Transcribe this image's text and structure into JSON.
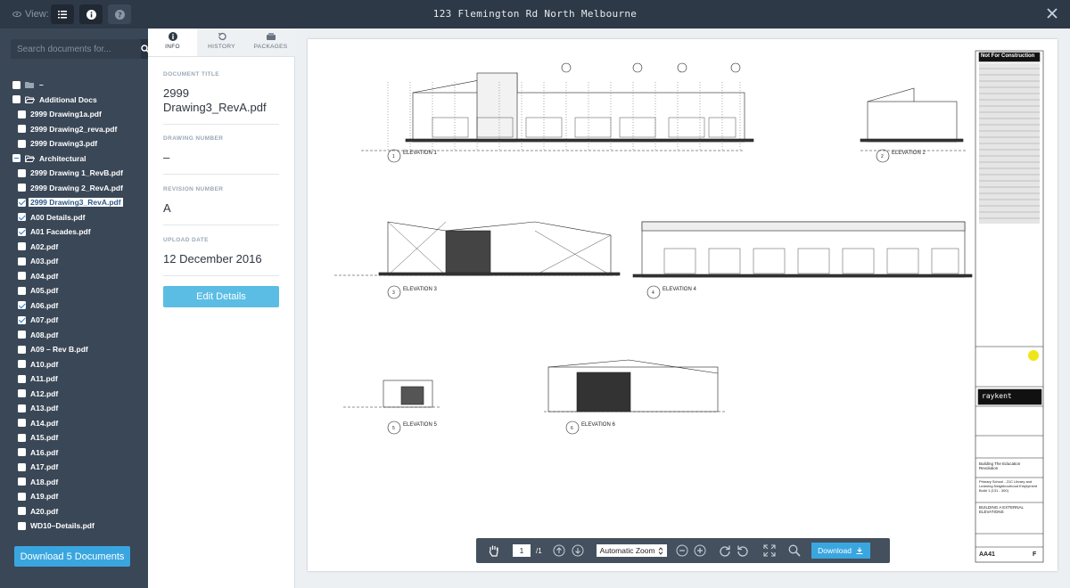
{
  "topbar": {
    "view_label": "View:",
    "title": "123 Flemington Rd North Melbourne"
  },
  "sidebar": {
    "search_placeholder": "Search documents for...",
    "items": [
      {
        "label": "–",
        "state": "unchecked",
        "folder": true,
        "indent": 0
      },
      {
        "label": "Additional Docs",
        "state": "unchecked",
        "folder": true,
        "indent": 0
      },
      {
        "label": "2999 Drawing1a.pdf",
        "state": "unchecked",
        "indent": 1
      },
      {
        "label": "2999 Drawing2_reva.pdf",
        "state": "unchecked",
        "indent": 1
      },
      {
        "label": "2999 Drawing3.pdf",
        "state": "unchecked",
        "indent": 1
      },
      {
        "label": "Architectural",
        "state": "partial",
        "folder": true,
        "indent": 0
      },
      {
        "label": "2999 Drawing 1_RevB.pdf",
        "state": "unchecked",
        "indent": 1
      },
      {
        "label": "2999 Drawing 2_RevA.pdf",
        "state": "unchecked",
        "indent": 1
      },
      {
        "label": "2999 Drawing3_RevA.pdf",
        "state": "checked",
        "indent": 1,
        "selected": true
      },
      {
        "label": "A00 Details.pdf",
        "state": "checked",
        "indent": 1
      },
      {
        "label": "A01 Facades.pdf",
        "state": "checked",
        "indent": 1
      },
      {
        "label": "A02.pdf",
        "state": "unchecked",
        "indent": 1
      },
      {
        "label": "A03.pdf",
        "state": "unchecked",
        "indent": 1
      },
      {
        "label": "A04.pdf",
        "state": "unchecked",
        "indent": 1
      },
      {
        "label": "A05.pdf",
        "state": "unchecked",
        "indent": 1
      },
      {
        "label": "A06.pdf",
        "state": "checked",
        "indent": 1
      },
      {
        "label": "A07.pdf",
        "state": "checked",
        "indent": 1
      },
      {
        "label": "A08.pdf",
        "state": "unchecked",
        "indent": 1
      },
      {
        "label": "A09 – Rev B.pdf",
        "state": "unchecked",
        "indent": 1
      },
      {
        "label": "A10.pdf",
        "state": "unchecked",
        "indent": 1
      },
      {
        "label": "A11.pdf",
        "state": "unchecked",
        "indent": 1
      },
      {
        "label": "A12.pdf",
        "state": "unchecked",
        "indent": 1
      },
      {
        "label": "A13.pdf",
        "state": "unchecked",
        "indent": 1
      },
      {
        "label": "A14.pdf",
        "state": "unchecked",
        "indent": 1
      },
      {
        "label": "A15.pdf",
        "state": "unchecked",
        "indent": 1
      },
      {
        "label": "A16.pdf",
        "state": "unchecked",
        "indent": 1
      },
      {
        "label": "A17.pdf",
        "state": "unchecked",
        "indent": 1
      },
      {
        "label": "A18.pdf",
        "state": "unchecked",
        "indent": 1
      },
      {
        "label": "A19.pdf",
        "state": "unchecked",
        "indent": 1
      },
      {
        "label": "A20.pdf",
        "state": "unchecked",
        "indent": 1
      },
      {
        "label": "WD10–Details.pdf",
        "state": "unchecked",
        "indent": 1
      }
    ],
    "download_label": "Download 5 Documents"
  },
  "info_panel": {
    "tabs": [
      {
        "label": "INFO",
        "icon": "info-icon",
        "active": true
      },
      {
        "label": "HISTORY",
        "icon": "history-icon",
        "active": false
      },
      {
        "label": "PACKAGES",
        "icon": "packages-icon",
        "active": false
      }
    ],
    "fields": [
      {
        "label": "DOCUMENT TITLE",
        "value": "2999 Drawing3_RevA.pdf"
      },
      {
        "label": "DRAWING NUMBER",
        "value": "–"
      },
      {
        "label": "REVISION NUMBER",
        "value": "A"
      },
      {
        "label": "UPLOAD DATE",
        "value": "12 December 2016"
      }
    ],
    "edit_label": "Edit Details"
  },
  "viewer": {
    "elevations": [
      "ELEVATION 1",
      "ELEVATION 2",
      "ELEVATION 3",
      "ELEVATION 4",
      "ELEVATION 5",
      "ELEVATION 6"
    ],
    "elevation_numbers": [
      "1",
      "2",
      "3",
      "4",
      "5",
      "6"
    ],
    "titleblock": {
      "stamp": "Not For Construction",
      "company": "raykent",
      "project": "Building The Education Revolution",
      "description": "Primary School - 21C Library and Learning Neighbourhood Emplyment Build 1 (131 - 300)",
      "sheet_title": "BUILDING A EXTERNAL ELEVATIONS",
      "drawing_no": "AA41",
      "revision": "F"
    },
    "toolbar": {
      "page": "1",
      "total": "/1",
      "zoom": "Automatic Zoom",
      "download_label": "Download"
    }
  },
  "colors": {
    "accent": "#3aa6e0",
    "sidebar_bg": "#3a4757",
    "topbar_bg": "#2e3947"
  }
}
